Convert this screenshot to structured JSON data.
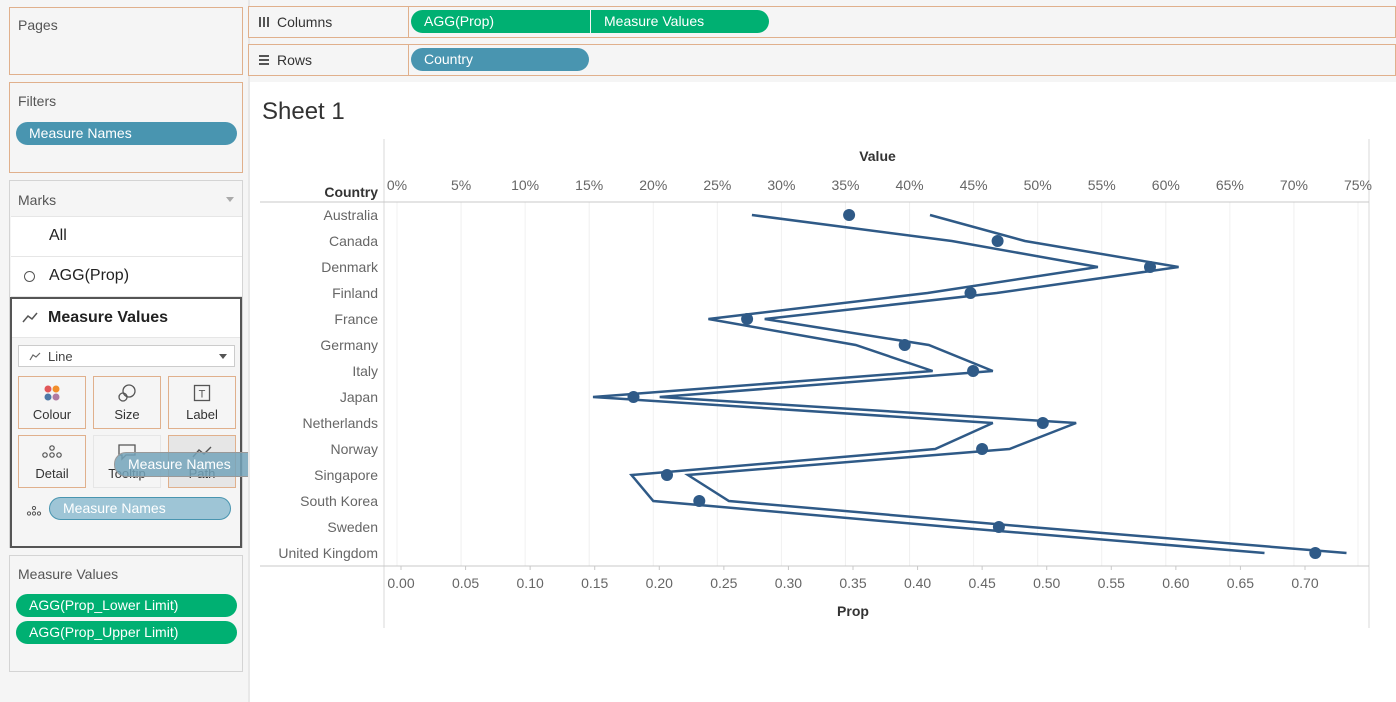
{
  "pages": {
    "title": "Pages"
  },
  "filters": {
    "title": "Filters",
    "pill": "Measure Names"
  },
  "marks": {
    "title": "Marks",
    "all_label": "All",
    "agg_label": "AGG(Prop)",
    "measure_values_label": "Measure Values",
    "mark_type": "Line",
    "buttons": {
      "colour": "Colour",
      "size": "Size",
      "label": "Label",
      "detail": "Detail",
      "tooltip": "Tooltip",
      "path": "Path"
    },
    "detail_pill": "Measure Names",
    "dragging_pill": "Measure Names"
  },
  "measure_values_card": {
    "title": "Measure Values",
    "items": [
      "AGG(Prop_Lower Limit)",
      "AGG(Prop_Upper Limit)"
    ]
  },
  "columns_shelf": {
    "label": "Columns",
    "pills": [
      "AGG(Prop)",
      "Measure Values"
    ]
  },
  "rows_shelf": {
    "label": "Rows",
    "pills": [
      "Country"
    ]
  },
  "sheet": {
    "title": "Sheet 1"
  },
  "colors": {
    "green_pill": "#00b072",
    "blue_pill": "#4995b0",
    "mark": "#2f5a87",
    "shelf_border": "#e0b08c"
  },
  "chart_data": {
    "type": "line",
    "row_header": "Country",
    "top_axis_title": "Value",
    "bottom_axis_title": "Prop",
    "top_ticks": [
      "0%",
      "5%",
      "10%",
      "15%",
      "20%",
      "25%",
      "30%",
      "35%",
      "40%",
      "45%",
      "50%",
      "55%",
      "60%",
      "65%",
      "70%",
      "75%"
    ],
    "bottom_ticks": [
      "0.00",
      "0.05",
      "0.10",
      "0.15",
      "0.20",
      "0.25",
      "0.30",
      "0.35",
      "0.40",
      "0.45",
      "0.50",
      "0.55",
      "0.60",
      "0.65",
      "0.70"
    ],
    "countries": [
      "Australia",
      "Canada",
      "Denmark",
      "Finland",
      "France",
      "Germany",
      "Italy",
      "Japan",
      "Netherlands",
      "Norway",
      "Singapore",
      "South Korea",
      "Sweden",
      "United Kingdom"
    ],
    "prop": [
      0.347,
      0.462,
      0.58,
      0.441,
      0.268,
      0.39,
      0.443,
      0.18,
      0.497,
      0.45,
      0.206,
      0.231,
      0.463,
      0.708
    ],
    "lower_limit": [
      0.277,
      0.433,
      0.547,
      0.414,
      0.243,
      0.358,
      0.418,
      0.153,
      0.465,
      0.42,
      0.183,
      0.2,
      0.432,
      0.677
    ],
    "upper_limit": [
      0.416,
      0.49,
      0.61,
      0.468,
      0.287,
      0.415,
      0.465,
      0.205,
      0.53,
      0.478,
      0.227,
      0.259,
      0.494,
      0.741
    ],
    "top_range": [
      0,
      0.75
    ],
    "bottom_range": [
      0,
      0.7
    ]
  }
}
